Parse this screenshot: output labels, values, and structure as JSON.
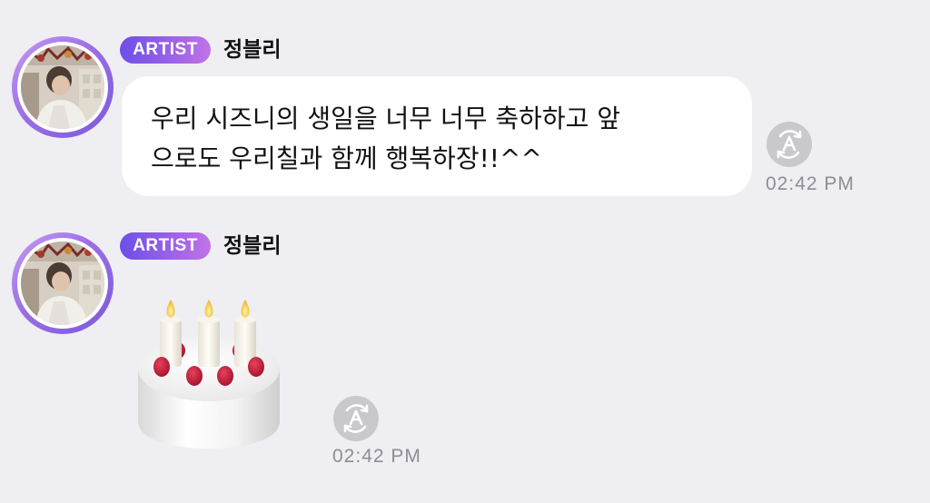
{
  "messages": [
    {
      "badge": "ARTIST",
      "author": "정블리",
      "text_lines": [
        "우리 시즈니의 생일을 너무 너무 축하하고 앞",
        "으로도 우리칠과 함께 행복하장!!^^"
      ],
      "time": "02:42 PM",
      "translate_icon": "translate-icon"
    },
    {
      "badge": "ARTIST",
      "author": "정블리",
      "emoji": "birthday-cake",
      "time": "02:42 PM",
      "translate_icon": "translate-icon"
    }
  ],
  "colors": {
    "background": "#efeef2",
    "badge_gradient_start": "#6d4fe6",
    "badge_gradient_end": "#c173e6",
    "avatar_ring": "#9b6ee6",
    "time_text": "#8e8d93",
    "translate_button": "#c9c8cd"
  }
}
